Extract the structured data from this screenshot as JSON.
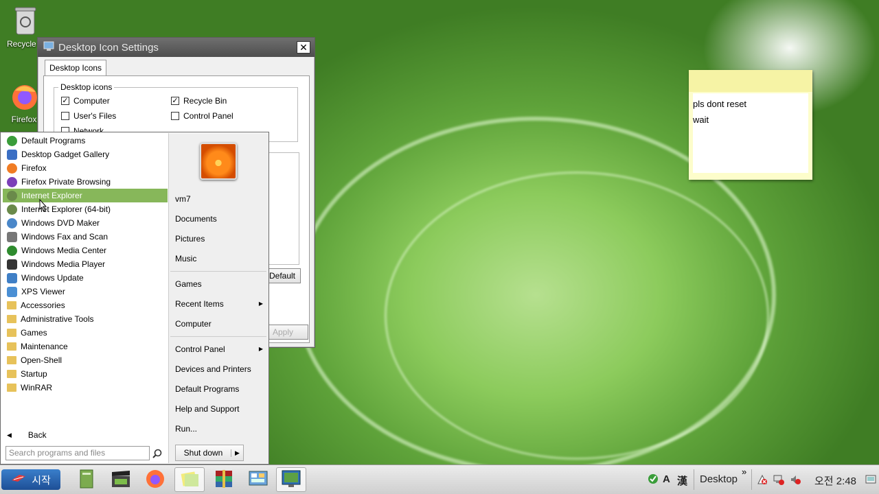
{
  "desktop": {
    "icons": [
      {
        "label": "Recycle B",
        "icon": "recycle-bin-icon"
      },
      {
        "label": "Firefox",
        "icon": "firefox-icon"
      }
    ]
  },
  "dialog": {
    "title": "Desktop Icon Settings",
    "tab": "Desktop Icons",
    "group_label": "Desktop icons",
    "checkboxes": [
      {
        "label": "Computer",
        "checked": true
      },
      {
        "label": "Recycle Bin",
        "checked": true
      },
      {
        "label": "User's Files",
        "checked": false
      },
      {
        "label": "Control Panel",
        "checked": false
      },
      {
        "label": "Network",
        "checked": false
      }
    ],
    "default_button": "Default",
    "apply_button": "Apply"
  },
  "start_menu": {
    "programs": [
      {
        "label": "Default Programs",
        "icon": "default-programs-icon",
        "color": "#3a9d3a"
      },
      {
        "label": "Desktop Gadget Gallery",
        "icon": "gadget-icon",
        "color": "#3b6fc4"
      },
      {
        "label": "Firefox",
        "icon": "firefox-icon",
        "color": "#f07c24"
      },
      {
        "label": "Firefox Private Browsing",
        "icon": "firefox-private-icon",
        "color": "#7b3fb8"
      },
      {
        "label": "Internet Explorer",
        "icon": "internet-explorer-icon",
        "color": "#6a8a4a",
        "highlighted": true
      },
      {
        "label": "Internet Explorer (64-bit)",
        "icon": "internet-explorer-icon",
        "color": "#6a8a4a"
      },
      {
        "label": "Windows DVD Maker",
        "icon": "dvd-maker-icon",
        "color": "#4a87c9"
      },
      {
        "label": "Windows Fax and Scan",
        "icon": "fax-scan-icon",
        "color": "#777777"
      },
      {
        "label": "Windows Media Center",
        "icon": "media-center-icon",
        "color": "#2e8b2e"
      },
      {
        "label": "Windows Media Player",
        "icon": "media-player-icon",
        "color": "#333333"
      },
      {
        "label": "Windows Update",
        "icon": "windows-update-icon",
        "color": "#3f7fc6"
      },
      {
        "label": "XPS Viewer",
        "icon": "xps-viewer-icon",
        "color": "#4a8fd4"
      },
      {
        "label": "Accessories",
        "icon": "folder-icon"
      },
      {
        "label": "Administrative Tools",
        "icon": "folder-icon"
      },
      {
        "label": "Games",
        "icon": "folder-icon"
      },
      {
        "label": "Maintenance",
        "icon": "folder-icon"
      },
      {
        "label": "Open-Shell",
        "icon": "folder-icon"
      },
      {
        "label": "Startup",
        "icon": "folder-icon"
      },
      {
        "label": "WinRAR",
        "icon": "folder-icon"
      }
    ],
    "back_label": "Back",
    "search_placeholder": "Search programs and files",
    "right_links": {
      "user": "vm7",
      "documents": "Documents",
      "pictures": "Pictures",
      "music": "Music",
      "games": "Games",
      "recent_items": "Recent Items",
      "computer": "Computer",
      "control_panel": "Control Panel",
      "devices_printers": "Devices and Printers",
      "default_programs": "Default Programs",
      "help_support": "Help and Support",
      "run": "Run..."
    },
    "shutdown_label": "Shut down"
  },
  "sticky_note": {
    "lines": [
      "pls dont reset",
      "wait"
    ]
  },
  "taskbar": {
    "start_label": "시작",
    "pinned": [
      {
        "icon": "notepad-icon"
      },
      {
        "icon": "movie-maker-icon"
      },
      {
        "icon": "firefox-icon"
      },
      {
        "icon": "sticky-notes-icon",
        "active": true
      },
      {
        "icon": "winrar-icon"
      },
      {
        "icon": "control-panel-icon"
      },
      {
        "icon": "desktop-settings-icon",
        "active": true
      }
    ],
    "ime_a": "A",
    "ime_han": "漢",
    "desktop_label": "Desktop",
    "overflow": "»",
    "clock": "오전 2:48"
  }
}
